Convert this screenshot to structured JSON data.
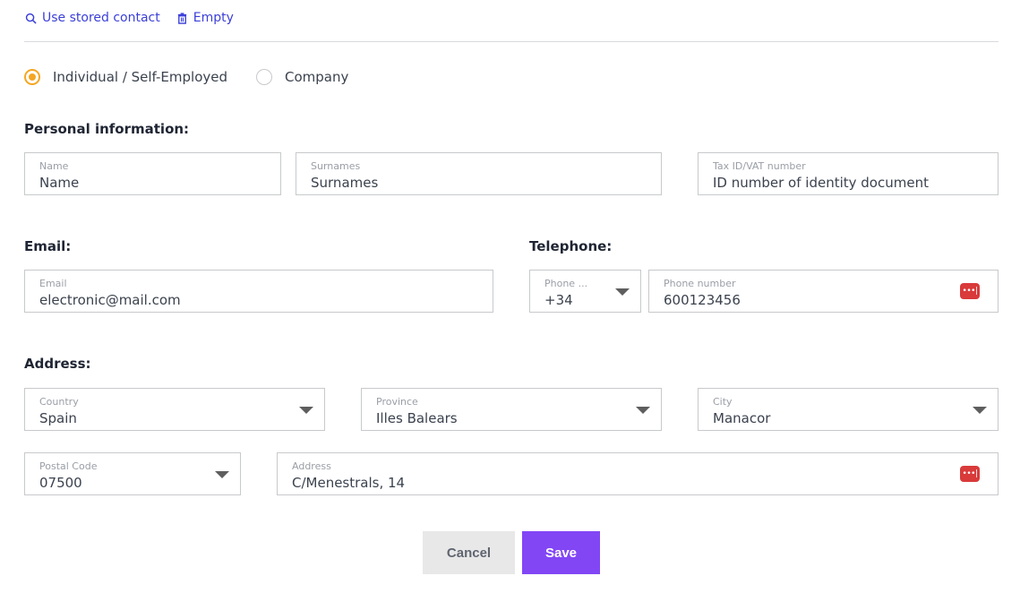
{
  "toolbar": {
    "use_stored_contact": "Use stored contact",
    "empty": "Empty"
  },
  "entity_type": {
    "options": [
      {
        "label": "Individual / Self-Employed",
        "selected": true
      },
      {
        "label": "Company",
        "selected": false
      }
    ]
  },
  "personal": {
    "title": "Personal information:",
    "name": {
      "label": "Name",
      "value": "Name"
    },
    "surnames": {
      "label": "Surnames",
      "value": "Surnames"
    },
    "tax_id": {
      "label": "Tax ID/VAT number",
      "value": "ID number of identity document"
    }
  },
  "email": {
    "title": "Email:",
    "field": {
      "label": "Email",
      "value": "electronic@mail.com"
    }
  },
  "telephone": {
    "title": "Telephone:",
    "prefix": {
      "label": "Phone ...",
      "value": "+34"
    },
    "number": {
      "label": "Phone number",
      "value": "600123456"
    }
  },
  "address": {
    "title": "Address:",
    "country": {
      "label": "Country",
      "value": "Spain"
    },
    "province": {
      "label": "Province",
      "value": "Illes Balears"
    },
    "city": {
      "label": "City",
      "value": "Manacor"
    },
    "postal_code": {
      "label": "Postal Code",
      "value": "07500"
    },
    "street": {
      "label": "Address",
      "value": "C/Menestrals, 14"
    }
  },
  "actions": {
    "cancel": "Cancel",
    "save": "Save"
  },
  "icons": {
    "password_manager": "•••|"
  }
}
